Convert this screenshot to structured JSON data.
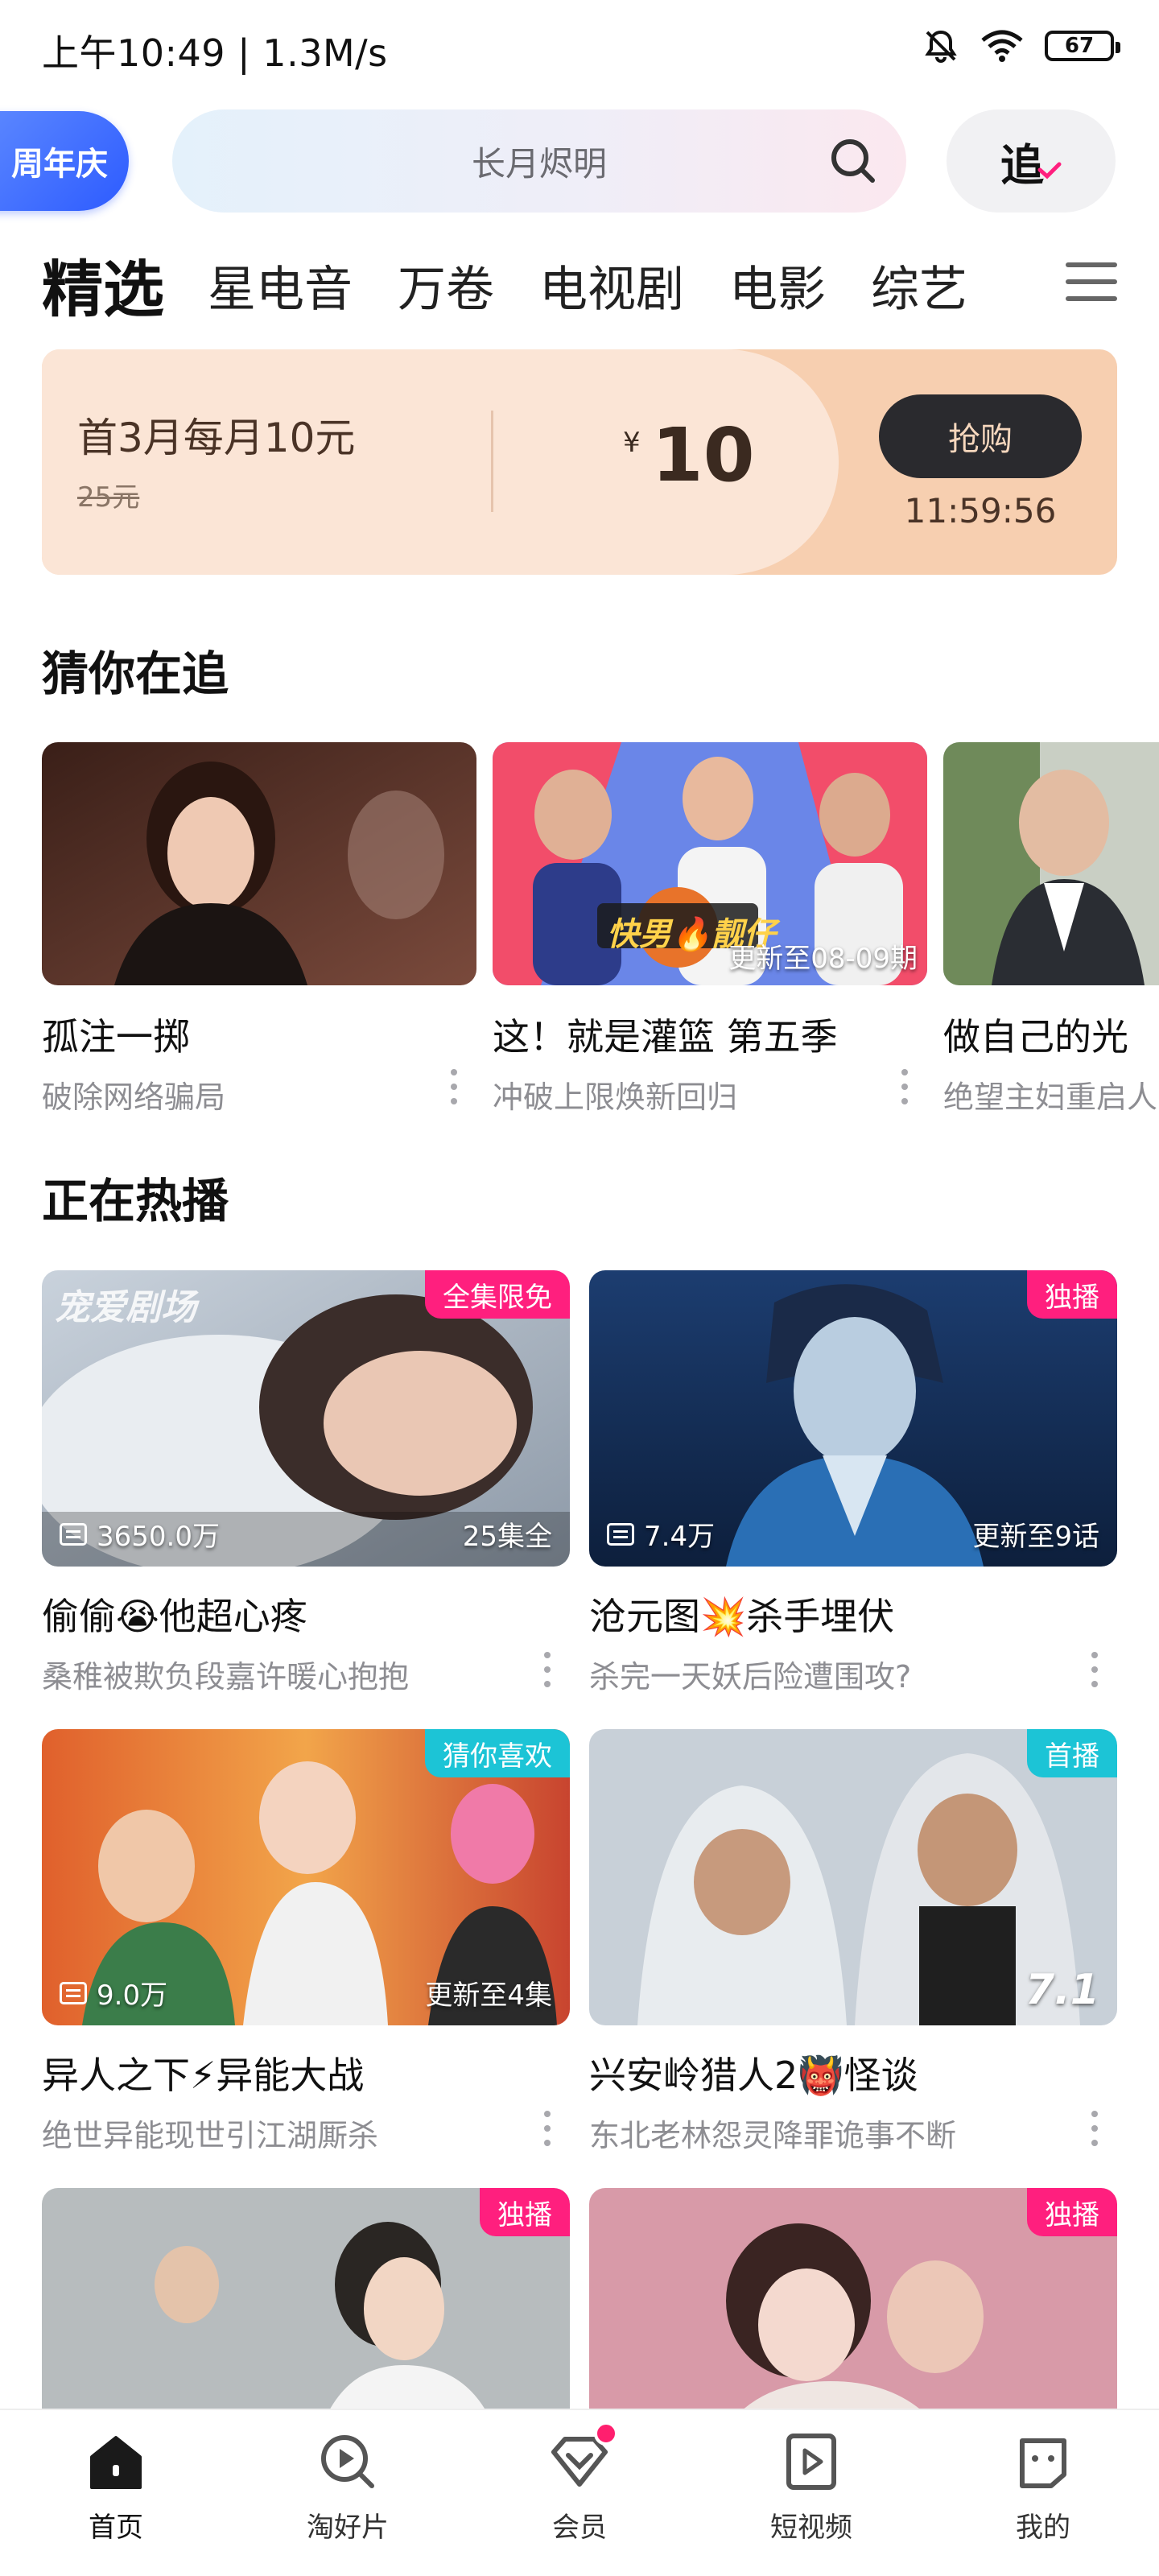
{
  "status_bar": {
    "left_text": "上午10:49 | 1.3M/s",
    "battery": "67"
  },
  "header": {
    "anniversary_label": "周年庆",
    "search_placeholder": "长月烬明",
    "follow_label": "追"
  },
  "tabs": [
    {
      "label": "精选",
      "active": true
    },
    {
      "label": "星电音"
    },
    {
      "label": "万卷"
    },
    {
      "label": "电视剧"
    },
    {
      "label": "电影"
    },
    {
      "label": "综艺"
    }
  ],
  "promo": {
    "title": "首3月每月10元",
    "original_price": "25元",
    "currency": "¥",
    "price": "10",
    "buy_label": "抢购",
    "countdown": "11:59:56"
  },
  "guess_section": {
    "title": "猜你在追",
    "items": [
      {
        "title": "孤注一掷",
        "subtitle": "破除网络骗局",
        "overlay": ""
      },
      {
        "title": "这！就是灌篮 第五季",
        "subtitle": "冲破上限焕新回归",
        "overlay": "更新至08-09期",
        "thumb_text": "快男🔥靓仔"
      },
      {
        "title": "做自己的光",
        "subtitle": "绝望主妇重启人生",
        "overlay": ""
      }
    ]
  },
  "hot_section": {
    "title": "正在热播",
    "items": [
      {
        "title": "偷偷😭他超心疼",
        "subtitle": "桑稚被欺负段嘉许暖心抱抱",
        "badge": "全集限免",
        "badge_color": "#ff1f7e",
        "plays": "3650.0万",
        "episode": "25集全",
        "watermark": "宠爱剧场"
      },
      {
        "title": "沧元图💥杀手埋伏",
        "subtitle": "杀完一天妖后险遭围攻?",
        "badge": "独播",
        "badge_color": "#ff1f7e",
        "plays": "7.4万",
        "episode": "更新至9话"
      },
      {
        "title": "异人之下⚡异能大战",
        "subtitle": "绝世异能现世引江湖厮杀",
        "badge": "猜你喜欢",
        "badge_color": "#1cc4d6",
        "plays": "9.0万",
        "episode": "更新至4集"
      },
      {
        "title": "兴安岭猎人2👹怪谈",
        "subtitle": "东北老林怨灵降罪诡事不断",
        "badge": "首播",
        "badge_color": "#1cc4d6",
        "score": "7.1"
      },
      {
        "title": "",
        "subtitle": "",
        "badge": "独播",
        "badge_color": "#ff1f7e"
      },
      {
        "title": "",
        "subtitle": "",
        "badge": "独播",
        "badge_color": "#ff1f7e"
      }
    ]
  },
  "bottom_nav": [
    {
      "label": "首页",
      "icon": "home-icon",
      "active": true
    },
    {
      "label": "淘好片",
      "icon": "discover-icon"
    },
    {
      "label": "会员",
      "icon": "vip-icon",
      "dot": true
    },
    {
      "label": "短视频",
      "icon": "short-video-icon"
    },
    {
      "label": "我的",
      "icon": "profile-icon"
    }
  ],
  "colors": {
    "accent_pink": "#ff1f7e",
    "accent_teal": "#1cc4d6",
    "promo_bg": "#fbe5d6"
  }
}
